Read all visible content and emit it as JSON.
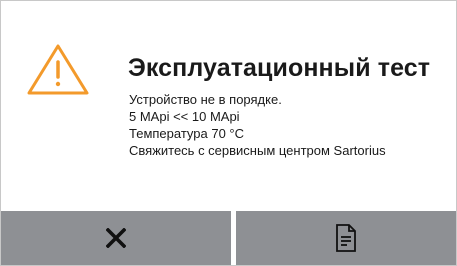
{
  "dialog": {
    "title": "Эксплуатационный тест",
    "icon": "warning-triangle-icon",
    "accent_color": "#f39a2b",
    "message_lines": [
      "Устройство не в порядке.",
      "5 MApi << 10 MApi",
      "Температура 70 °C",
      "Свяжитесь с сервисным центром Sartorius"
    ]
  },
  "buttons": {
    "cancel_icon": "close-icon",
    "document_icon": "document-icon",
    "bar_color": "#8e9094"
  }
}
